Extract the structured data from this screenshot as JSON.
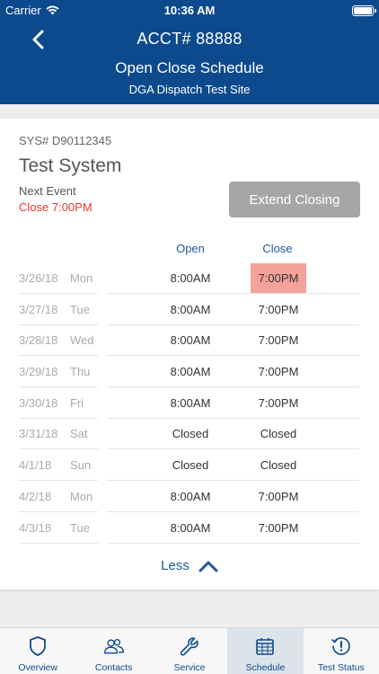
{
  "status_bar": {
    "carrier": "Carrier",
    "time": "10:36 AM"
  },
  "header": {
    "account": "ACCT# 88888",
    "title": "Open Close Schedule",
    "site": "DGA Dispatch Test Site"
  },
  "system": {
    "sys_number": "SYS# D90112345",
    "name": "Test System",
    "next_event_label": "Next Event",
    "next_event_value": "Close 7:00PM",
    "extend_button": "Extend Closing"
  },
  "columns": {
    "open": "Open",
    "close": "Close"
  },
  "schedule": [
    {
      "date": "3/26/18",
      "day": "Mon",
      "open": "8:00AM",
      "close": "7:00PM",
      "highlight": true
    },
    {
      "date": "3/27/18",
      "day": "Tue",
      "open": "8:00AM",
      "close": "7:00PM",
      "highlight": false
    },
    {
      "date": "3/28/18",
      "day": "Wed",
      "open": "8:00AM",
      "close": "7:00PM",
      "highlight": false
    },
    {
      "date": "3/29/18",
      "day": "Thu",
      "open": "8:00AM",
      "close": "7:00PM",
      "highlight": false
    },
    {
      "date": "3/30/18",
      "day": "Fri",
      "open": "8:00AM",
      "close": "7:00PM",
      "highlight": false
    },
    {
      "date": "3/31/18",
      "day": "Sat",
      "open": "Closed",
      "close": "Closed",
      "highlight": false
    },
    {
      "date": "4/1/18",
      "day": "Sun",
      "open": "Closed",
      "close": "Closed",
      "highlight": false
    },
    {
      "date": "4/2/18",
      "day": "Mon",
      "open": "8:00AM",
      "close": "7:00PM",
      "highlight": false
    },
    {
      "date": "4/3/18",
      "day": "Tue",
      "open": "8:00AM",
      "close": "7:00PM",
      "highlight": false
    }
  ],
  "less_label": "Less",
  "tabs": [
    {
      "label": "Overview",
      "icon": "shield-icon"
    },
    {
      "label": "Contacts",
      "icon": "contacts-icon"
    },
    {
      "label": "Service",
      "icon": "wrench-icon"
    },
    {
      "label": "Schedule",
      "icon": "calendar-icon",
      "active": true
    },
    {
      "label": "Test Status",
      "icon": "clock-alert-icon"
    }
  ],
  "colors": {
    "header_bg": "#0d4a8d",
    "accent": "#1d5a99",
    "alert": "#e53935",
    "highlight": "#f4a29a",
    "button_disabled": "#a6a6a6"
  }
}
